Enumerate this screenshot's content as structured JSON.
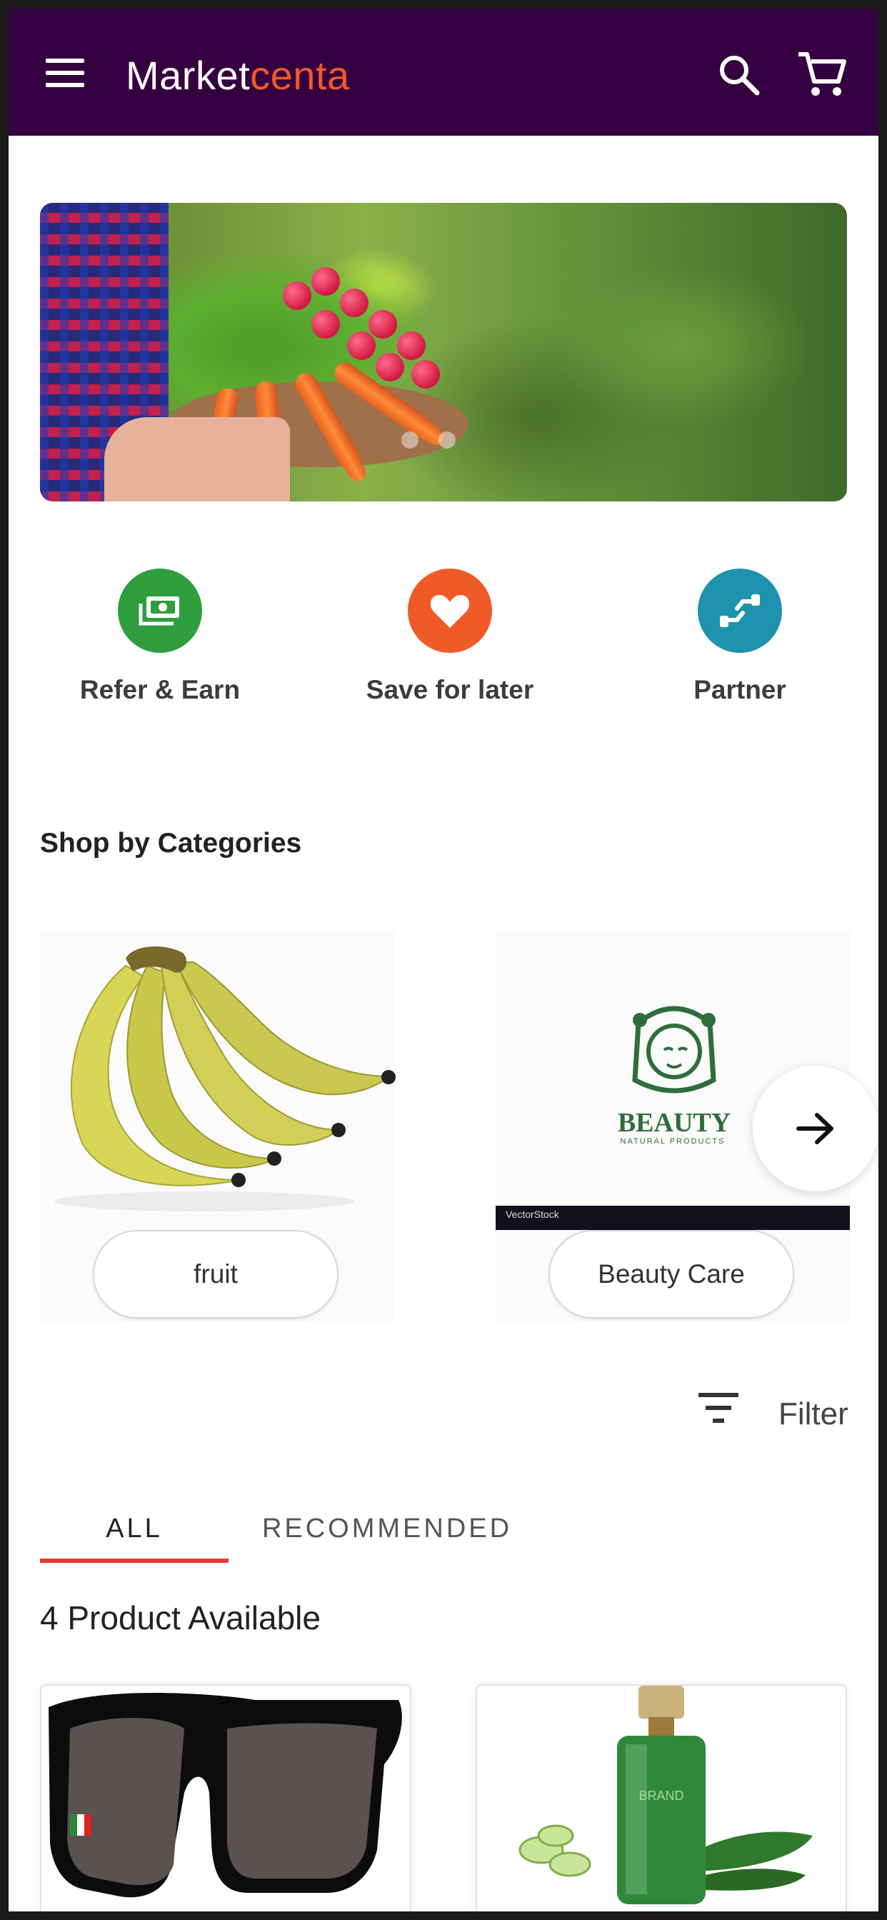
{
  "app": {
    "brand_main": "Market",
    "brand_accent": "centa",
    "colors": {
      "appbar": "#35003f",
      "accent": "#ef5a28",
      "tab_indicator": "#e53935"
    }
  },
  "banner": {
    "slide_count": 2,
    "active_slide": 1
  },
  "quick_actions": [
    {
      "label": "Refer & Earn",
      "icon": "money-icon",
      "color": "#2e9e3e"
    },
    {
      "label": "Save for later",
      "icon": "heart-icon",
      "color": "#ef5a28"
    },
    {
      "label": "Partner",
      "icon": "handshake-icon",
      "color": "#1e93ad"
    }
  ],
  "categories": {
    "title": "Shop by Categories",
    "items": [
      {
        "label": "fruit",
        "image": "bananas-image"
      },
      {
        "label": "Beauty Care",
        "image": "beauty-logo-image",
        "logo_text": "BEAUTY",
        "logo_subtext": "NATURAL PRODUCTS",
        "watermark": "VectorStock"
      }
    ]
  },
  "filter": {
    "label": "Filter"
  },
  "tabs": [
    {
      "label": "ALL",
      "active": true
    },
    {
      "label": "RECOMMENDED",
      "active": false
    }
  ],
  "products": {
    "count_label": "4 Product Available",
    "items": [
      {
        "image": "sunglasses-image"
      },
      {
        "image": "perfume-bottle-image",
        "bottle_text": "BRAND"
      }
    ]
  }
}
